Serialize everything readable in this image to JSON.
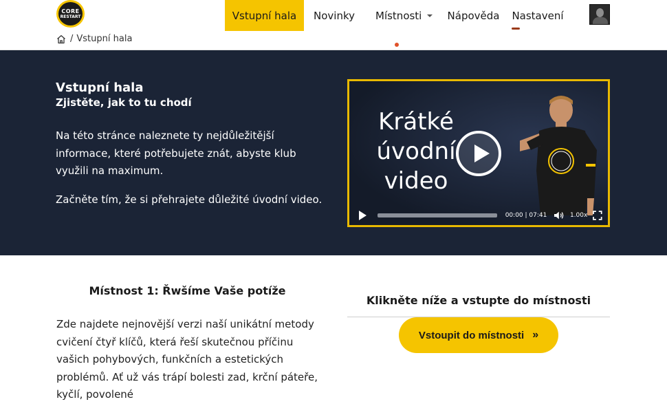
{
  "brand": {
    "logo_line1": "CORE",
    "logo_line2": "RESTART"
  },
  "nav": {
    "items": [
      {
        "label": "Vstupní hala"
      },
      {
        "label": "Novinky"
      },
      {
        "label": "Místnosti"
      },
      {
        "label": "Nápověda"
      },
      {
        "label": "Nastavení"
      }
    ]
  },
  "breadcrumb": {
    "separator": "/",
    "current": "Vstupní hala"
  },
  "hero": {
    "title": "Vstupní hala",
    "subtitle": "Zjistěte, jak to tu chodí",
    "paragraph1": "Na této stránce naleznete ty nejdůležitější informace, které potřebujete znát, abyste klub využili na maximum.",
    "paragraph2": "Začněte tím, že si přehrajete důležité úvodní video."
  },
  "video": {
    "overlay_text_line1": "Krátké",
    "overlay_text_line2": "úvodní",
    "overlay_text_line3": "video",
    "time": "00:00 | 07:41",
    "speed": "1.00x",
    "progress": 0
  },
  "room": {
    "title": "Místnost 1: Řwšíme Vaše potíže",
    "description": "Zde najdete nejnovější verzi naší unikátní metody cvičení čtyř klíčů, která řeší skutečnou příčinu vašich pohybových, funkčních a estetických problémů. Ať už vás trápí bolesti zad, krční páteře, kyčlí, povolené"
  },
  "enter": {
    "heading": "Klikněte níže a vstupte do místnosti",
    "button_label": "Vstoupit do místnosti",
    "button_icon": "»"
  },
  "colors": {
    "accent": "#f5c400",
    "hero_bg": "#1b2436",
    "video_border": "#e8b900"
  }
}
